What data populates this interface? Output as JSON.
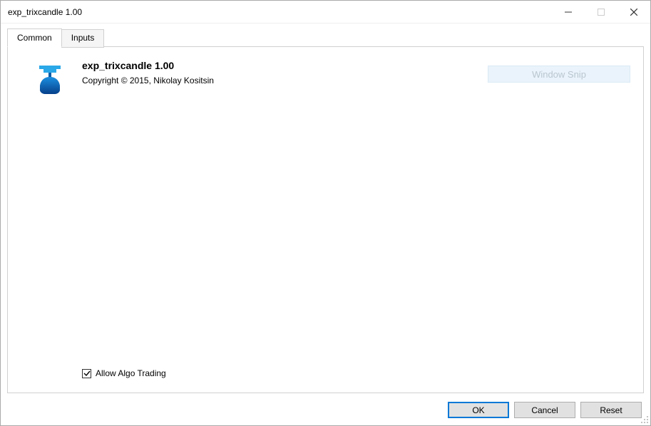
{
  "window": {
    "title": "exp_trixcandle 1.00"
  },
  "tabs": [
    {
      "label": "Common",
      "active": true
    },
    {
      "label": "Inputs",
      "active": false
    }
  ],
  "common": {
    "title": "exp_trixcandle 1.00",
    "copyright": "Copyright © 2015, Nikolay Kositsin",
    "snip_label": "Window Snip",
    "allow_algo": {
      "label": "Allow Algo Trading",
      "checked": true
    }
  },
  "buttons": {
    "ok": "OK",
    "cancel": "Cancel",
    "reset": "Reset"
  }
}
